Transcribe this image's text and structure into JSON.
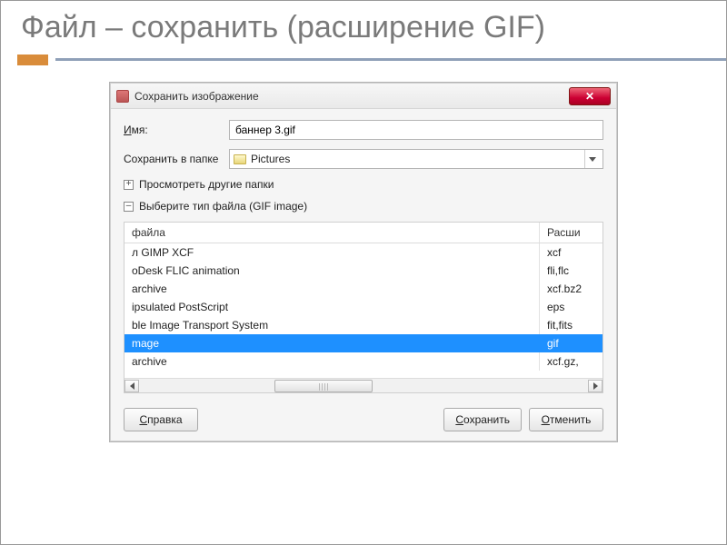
{
  "slide": {
    "title": "Файл – сохранить  (расширение GIF)"
  },
  "dialog": {
    "title": "Сохранить изображение",
    "name_label_pre": "И",
    "name_label_post": "мя:",
    "filename": "баннер 3.gif",
    "folder_label": "Сохранить в папке",
    "folder_value": "Pictures",
    "browse_toggle_symbol": "+",
    "browse_label": "Просмотреть другие папки",
    "type_toggle_symbol": "–",
    "type_label": "Выберите тип файла (GIF image)",
    "columns": {
      "name": "файла",
      "ext": "Расши"
    },
    "rows": [
      {
        "name": "л GIMP XCF",
        "ext": "xcf",
        "selected": false
      },
      {
        "name": "oDesk FLIC animation",
        "ext": "fli,flc",
        "selected": false
      },
      {
        "name": " archive",
        "ext": "xcf.bz2",
        "selected": false
      },
      {
        "name": "ipsulated PostScript",
        "ext": "eps",
        "selected": false
      },
      {
        "name": "ble Image Transport System",
        "ext": "fit,fits",
        "selected": false
      },
      {
        "name": "mage",
        "ext": "gif",
        "selected": true
      },
      {
        "name": " archive",
        "ext": "xcf.gz,",
        "selected": false
      }
    ],
    "buttons": {
      "help_pre": "С",
      "help_post": "правка",
      "save_pre": "С",
      "save_post": "охранить",
      "cancel_pre": "О",
      "cancel_post": "тменить"
    }
  }
}
